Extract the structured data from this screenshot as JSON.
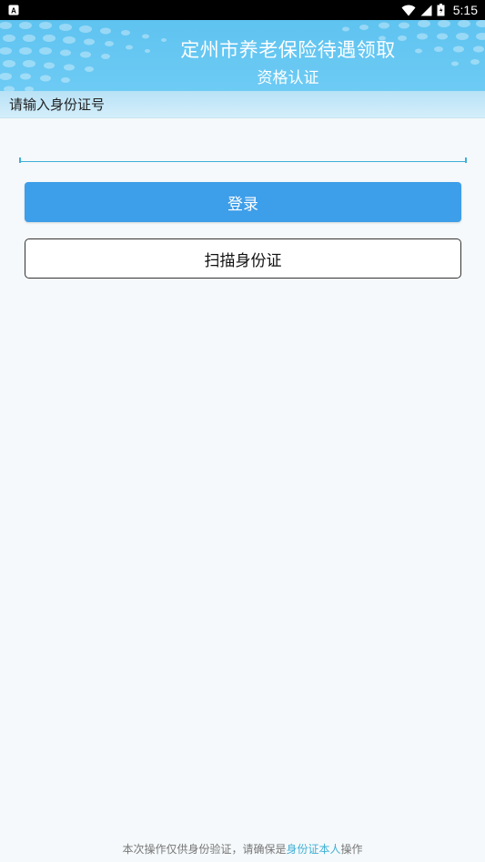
{
  "status_bar": {
    "time": "5:15"
  },
  "header": {
    "title": "定州市养老保险待遇领取",
    "subtitle": "资格认证"
  },
  "form": {
    "section_label": "请输入身份证号",
    "id_input_value": "",
    "id_input_placeholder": ""
  },
  "buttons": {
    "login_label": "登录",
    "scan_label": "扫描身份证"
  },
  "footer": {
    "prefix": "本次操作仅供身份验证，请确保是",
    "highlight": "身份证本人",
    "suffix": "操作"
  },
  "colors": {
    "header_blue": "#5fc3f0",
    "login_blue": "#3d9ee9",
    "accent_cyan": "#3fb0d6"
  }
}
